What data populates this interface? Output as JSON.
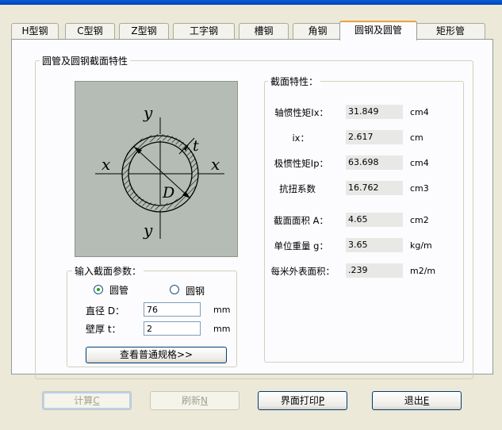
{
  "tabs": [
    {
      "label": "H型钢"
    },
    {
      "label": "C型钢"
    },
    {
      "label": "Z型钢"
    },
    {
      "label": "工字钢"
    },
    {
      "label": "槽钢"
    },
    {
      "label": "角钢"
    },
    {
      "label": "圆钢及圆管",
      "active": true
    },
    {
      "label": "矩形管"
    }
  ],
  "section_group_title": "圆管及圆钢截面特性",
  "diagram": {
    "labels": {
      "y_top": "y",
      "y_bottom": "y",
      "x_left": "x",
      "x_right": "x",
      "t": "t",
      "D": "D"
    }
  },
  "properties": {
    "title": "截面特性：",
    "rows": [
      {
        "label": "轴惯性矩Ix：",
        "value": "31.849",
        "unit": "cm4"
      },
      {
        "label": "ix：",
        "value": "2.617",
        "unit": "cm"
      },
      {
        "label": "极惯性矩Ip：",
        "value": "63.698",
        "unit": "cm4"
      },
      {
        "label": "抗扭系数",
        "value": "16.762",
        "unit": "cm3"
      },
      {
        "label": "截面面积 A：",
        "value": "4.65",
        "unit": "cm2"
      },
      {
        "label": "单位重量 g：",
        "value": "3.65",
        "unit": "kg/m"
      },
      {
        "label": "每米外表面积：",
        "value": ".239",
        "unit": "m2/m"
      }
    ]
  },
  "input": {
    "title": "输入截面参数：",
    "radio_tube": "圆管",
    "radio_bar": "圆钢",
    "selected": "tube",
    "diameter_label": "直径 D：",
    "diameter_value": "76",
    "diameter_unit": "mm",
    "thickness_label": "壁厚 t：",
    "thickness_value": "2",
    "thickness_unit": "mm",
    "spec_button": "查看普通规格>>"
  },
  "buttons": {
    "calc": {
      "text": "计算",
      "key": "C"
    },
    "refresh": {
      "text": "刷新",
      "key": "N"
    },
    "print": {
      "text": "界面打印",
      "key": "P"
    },
    "exit": {
      "text": "退出",
      "key": "E"
    }
  },
  "colors": {
    "active_tab_accent": "#e8a33d",
    "diagram_bg": "#b5bcb5",
    "window_bg": "#ece9d8"
  }
}
